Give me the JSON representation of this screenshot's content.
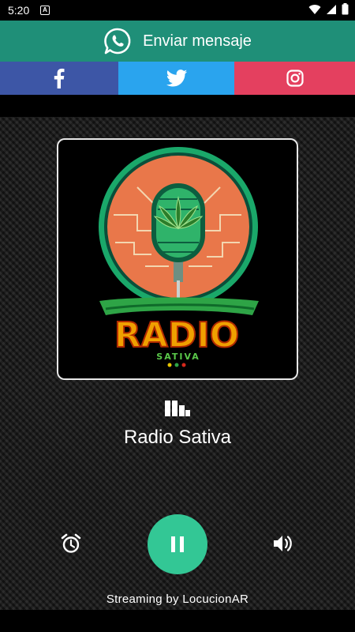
{
  "status_bar": {
    "time": "5:20",
    "badge": "A",
    "icons": [
      "wifi-icon",
      "signal-icon",
      "battery-icon"
    ]
  },
  "whatsapp": {
    "label": "Enviar mensaje",
    "icon": "whatsapp-icon",
    "color": "#1f8f78"
  },
  "social": [
    {
      "name": "facebook",
      "icon": "facebook-icon",
      "color": "#3d56a6"
    },
    {
      "name": "twitter",
      "icon": "twitter-icon",
      "color": "#2aa4ee"
    },
    {
      "name": "instagram",
      "icon": "instagram-icon",
      "color": "#e4405f"
    }
  ],
  "cover": {
    "logo_title": "RADIO",
    "logo_subtitle": "SATIVA"
  },
  "station": {
    "name": "Radio Sativa"
  },
  "controls": {
    "alarm_icon": "alarm-clock-icon",
    "play_state_icon": "pause-icon",
    "volume_icon": "volume-icon",
    "accent": "#33c795"
  },
  "footer": {
    "credit": "Streaming by LocucionAR"
  }
}
